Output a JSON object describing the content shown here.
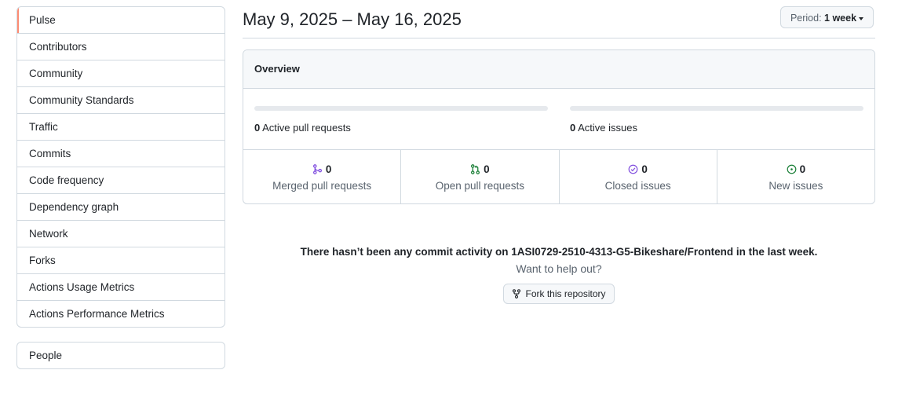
{
  "sidebar": {
    "items": [
      {
        "label": "Pulse",
        "selected": true
      },
      {
        "label": "Contributors"
      },
      {
        "label": "Community"
      },
      {
        "label": "Community Standards"
      },
      {
        "label": "Traffic"
      },
      {
        "label": "Commits"
      },
      {
        "label": "Code frequency"
      },
      {
        "label": "Dependency graph"
      },
      {
        "label": "Network"
      },
      {
        "label": "Forks"
      },
      {
        "label": "Actions Usage Metrics"
      },
      {
        "label": "Actions Performance Metrics"
      }
    ],
    "people": {
      "label": "People"
    }
  },
  "header": {
    "date_range": "May 9, 2025 – May 16, 2025",
    "period_label": "Period:",
    "period_value": "1 week"
  },
  "overview": {
    "title": "Overview",
    "active_pull_requests": {
      "count": "0",
      "label": "Active pull requests"
    },
    "active_issues": {
      "count": "0",
      "label": "Active issues"
    },
    "stats": [
      {
        "count": "0",
        "label": "Merged pull requests",
        "icon": "git-merge-icon",
        "color": "#8250df"
      },
      {
        "count": "0",
        "label": "Open pull requests",
        "icon": "git-pull-request-icon",
        "color": "#1a7f37"
      },
      {
        "count": "0",
        "label": "Closed issues",
        "icon": "issue-closed-icon",
        "color": "#8250df"
      },
      {
        "count": "0",
        "label": "New issues",
        "icon": "issue-opened-icon",
        "color": "#1a7f37"
      }
    ]
  },
  "empty_state": {
    "message": "There hasn’t been any commit activity on 1ASI0729-2510-4313-G5-Bikeshare/Frontend in the last week.",
    "sub": "Want to help out?",
    "fork_button": "Fork this repository"
  },
  "colors": {
    "selected_accent": "#fd8c73",
    "border": "#d1d9e0",
    "muted_text": "#59636e"
  }
}
